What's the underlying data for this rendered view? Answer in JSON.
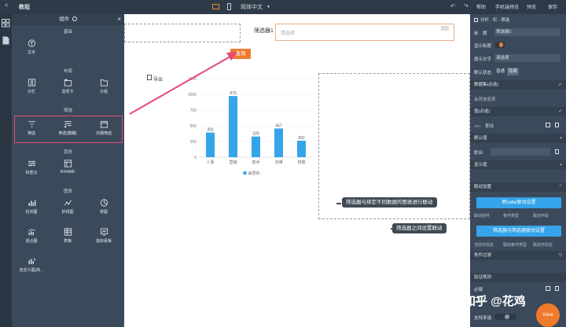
{
  "topbar": {
    "back": "<",
    "title": "教程",
    "lang": "简体中文",
    "right": [
      "帮助",
      "手机端预览",
      "预览",
      "保存"
    ]
  },
  "left_panel": {
    "title": "组件",
    "sections": [
      {
        "label": "基础",
        "items": [
          {
            "label": "文本",
            "icon": "text-icon"
          }
        ]
      },
      {
        "label": "布局",
        "items": [
          {
            "label": "分栏",
            "icon": "columns-icon"
          },
          {
            "label": "选项卡",
            "icon": "tabs-icon"
          },
          {
            "label": "分组",
            "icon": "folder-icon"
          }
        ]
      },
      {
        "label": "筛选",
        "items": [
          {
            "label": "筛选",
            "icon": "filter-icon"
          },
          {
            "label": "筛选(模糊)",
            "icon": "fuzzy-filter-icon"
          },
          {
            "label": "日期筛选",
            "icon": "calendar-icon"
          }
        ]
      },
      {
        "label": "其他",
        "items": [
          {
            "label": "标签云",
            "icon": "tag-cloud-icon"
          },
          {
            "label": "IFRAME",
            "icon": "iframe-icon"
          }
        ]
      },
      {
        "label": "图表",
        "items": [
          {
            "label": "柱状图",
            "icon": "bar-chart-icon"
          },
          {
            "label": "折线图",
            "icon": "line-chart-icon"
          },
          {
            "label": "饼图",
            "icon": "pie-chart-icon"
          },
          {
            "label": "混合图",
            "icon": "mixed-chart-icon"
          },
          {
            "label": "表格",
            "icon": "table-icon"
          },
          {
            "label": "指标看板",
            "icon": "kpi-board-icon"
          },
          {
            "label": "自定义图(高...",
            "icon": "custom-chart-icon"
          }
        ]
      }
    ]
  },
  "canvas": {
    "filter_label": "筛选器1",
    "filter_placeholder": "请选择",
    "query_button": "查询",
    "export_label": "导出"
  },
  "chart_data": {
    "type": "bar",
    "categories": [
      "人事",
      "营销",
      "技术",
      "法律",
      "管理"
    ],
    "values": [
      392,
      973,
      329,
      457,
      262
    ],
    "y_ticks": [
      "0",
      "250",
      "500",
      "750",
      "1000",
      "1250"
    ],
    "ylim": [
      0,
      1250
    ],
    "legend": "会员ID",
    "bar_color": "#35a4ea"
  },
  "callouts": {
    "one": "筛选器与绑定不同数据的图表进行联动",
    "two": "筛选器之间设置联动"
  },
  "right_panel": {
    "breadcrumb": "分栏 · 栏 · 筛选",
    "title_label": "标　题",
    "title_value": "筛选器1",
    "show_title_label": "显示标题",
    "hint_label": "提示文字",
    "hint_value": "请选择",
    "default_state_label": "默认状态",
    "state_normal": "普通",
    "state_hidden": "隐藏",
    "dataset_label": "数据集(必选)",
    "dataset_value": "会员信息表",
    "value_label": "值(必选)",
    "value_field": "职业",
    "default_value_label": "默认值",
    "default_value_field": "职业:",
    "display_value_label": "显示值",
    "link_settings_label": "联动设置",
    "cross_cube_button": "跨cube联动设置",
    "cols1": [
      "联动组件",
      "条件类型",
      "联动字段"
    ],
    "filter_link_button": "筛选器与筛选器联动设置",
    "cols2": [
      "当前字段名",
      "联动条件类型",
      "联动字段名"
    ],
    "condition_filter_label": "条件过滤",
    "validation_label": "验证规则",
    "required_label": "必填",
    "multi_label": "支持多选",
    "done_button": "Vone"
  },
  "watermark": "知乎 @花鸡"
}
